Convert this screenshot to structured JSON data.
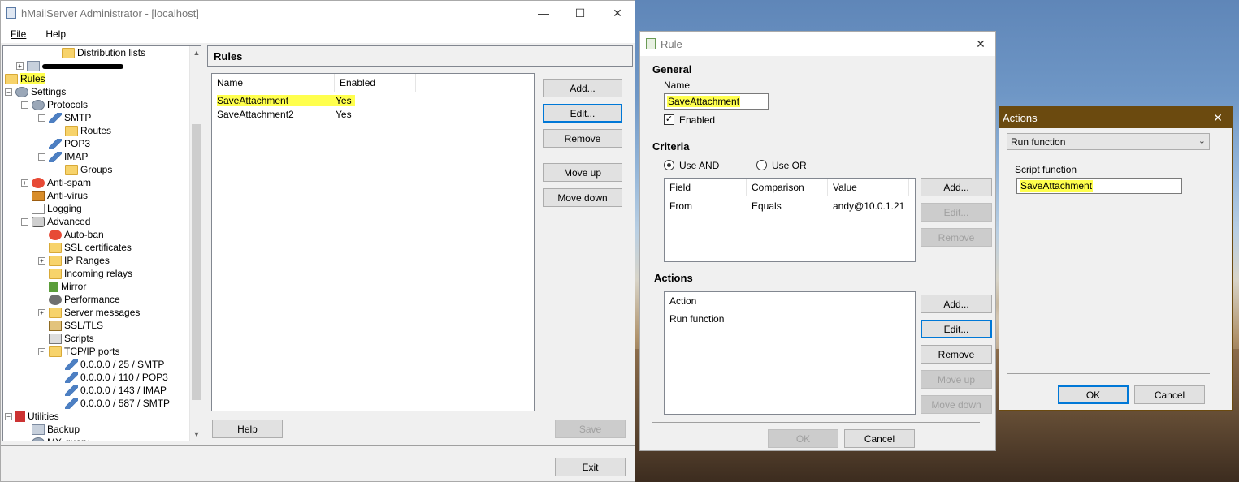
{
  "main_window": {
    "title": "hMailServer Administrator - [localhost]",
    "menu": [
      "File",
      "Help"
    ],
    "tree": [
      {
        "label": "Distribution lists",
        "icon": "folder-icon"
      },
      {
        "label": "",
        "icon": "server-icon"
      },
      {
        "label": "Rules",
        "icon": "folder-icon"
      },
      {
        "label": "Settings",
        "icon": "settings-icon"
      },
      {
        "label": "Protocols",
        "icon": "settings-icon"
      },
      {
        "label": "SMTP",
        "icon": "protocol-icon"
      },
      {
        "label": "Routes",
        "icon": "folder-icon"
      },
      {
        "label": "POP3",
        "icon": "protocol-icon"
      },
      {
        "label": "IMAP",
        "icon": "protocol-icon"
      },
      {
        "label": "Groups",
        "icon": "folder-icon"
      },
      {
        "label": "Anti-spam",
        "icon": "anti-spam-icon"
      },
      {
        "label": "Anti-virus",
        "icon": "anti-virus-icon"
      },
      {
        "label": "Logging",
        "icon": "log-icon"
      },
      {
        "label": "Advanced",
        "icon": "magnifier-icon"
      },
      {
        "label": "Auto-ban",
        "icon": "auto-ban-icon"
      },
      {
        "label": "SSL certificates",
        "icon": "folder-icon"
      },
      {
        "label": "IP Ranges",
        "icon": "folder-icon"
      },
      {
        "label": "Incoming relays",
        "icon": "folder-icon"
      },
      {
        "label": "Mirror",
        "icon": "mirror-icon"
      },
      {
        "label": "Performance",
        "icon": "performance-icon"
      },
      {
        "label": "Server messages",
        "icon": "folder-icon"
      },
      {
        "label": "SSL/TLS",
        "icon": "ssl-icon"
      },
      {
        "label": "Scripts",
        "icon": "script-icon"
      },
      {
        "label": "TCP/IP ports",
        "icon": "folder-icon"
      },
      {
        "label": "0.0.0.0 / 25 / SMTP",
        "icon": "port-icon"
      },
      {
        "label": "0.0.0.0 / 110 / POP3",
        "icon": "port-icon"
      },
      {
        "label": "0.0.0.0 / 143 / IMAP",
        "icon": "port-icon"
      },
      {
        "label": "0.0.0.0 / 587 / SMTP",
        "icon": "port-icon"
      },
      {
        "label": "Utilities",
        "icon": "utilities-icon"
      },
      {
        "label": "Backup",
        "icon": "server-icon"
      },
      {
        "label": "MX-query",
        "icon": "mx-query-icon"
      }
    ],
    "panel_title": "Rules",
    "rules_table": {
      "columns": [
        "Name",
        "Enabled"
      ],
      "rows": [
        {
          "name": "SaveAttachment",
          "enabled": "Yes"
        },
        {
          "name": "SaveAttachment2",
          "enabled": "Yes"
        }
      ]
    },
    "buttons": {
      "add": "Add...",
      "edit": "Edit...",
      "remove": "Remove",
      "move_up": "Move up",
      "move_down": "Move down",
      "help": "Help",
      "save": "Save",
      "exit": "Exit"
    }
  },
  "rule_dialog": {
    "title": "Rule",
    "general_label": "General",
    "name_label": "Name",
    "name_value": "SaveAttachment",
    "enabled_label": "Enabled",
    "enabled": true,
    "criteria_label": "Criteria",
    "use_and": "Use AND",
    "use_or": "Use OR",
    "criteria_table": {
      "columns": [
        "Field",
        "Comparison",
        "Value"
      ],
      "rows": [
        {
          "field": "From",
          "comparison": "Equals",
          "value": "andy@10.0.1.21"
        }
      ]
    },
    "criteria_buttons": {
      "add": "Add...",
      "edit": "Edit...",
      "remove": "Remove"
    },
    "actions_label": "Actions",
    "actions_table": {
      "columns": [
        "Action"
      ],
      "rows": [
        {
          "action": "Run function"
        }
      ]
    },
    "action_buttons": {
      "add": "Add...",
      "edit": "Edit...",
      "remove": "Remove",
      "move_up": "Move up",
      "move_down": "Move down"
    },
    "ok": "OK",
    "cancel": "Cancel"
  },
  "actions_dialog": {
    "title": "Actions",
    "action_type": "Run function",
    "script_function_label": "Script function",
    "script_function_value": "SaveAttachment",
    "ok": "OK",
    "cancel": "Cancel"
  },
  "colors": {
    "highlight": "#ffff4d",
    "focus": "#0078d7",
    "title_bar_dark": "#6b4a0f"
  }
}
